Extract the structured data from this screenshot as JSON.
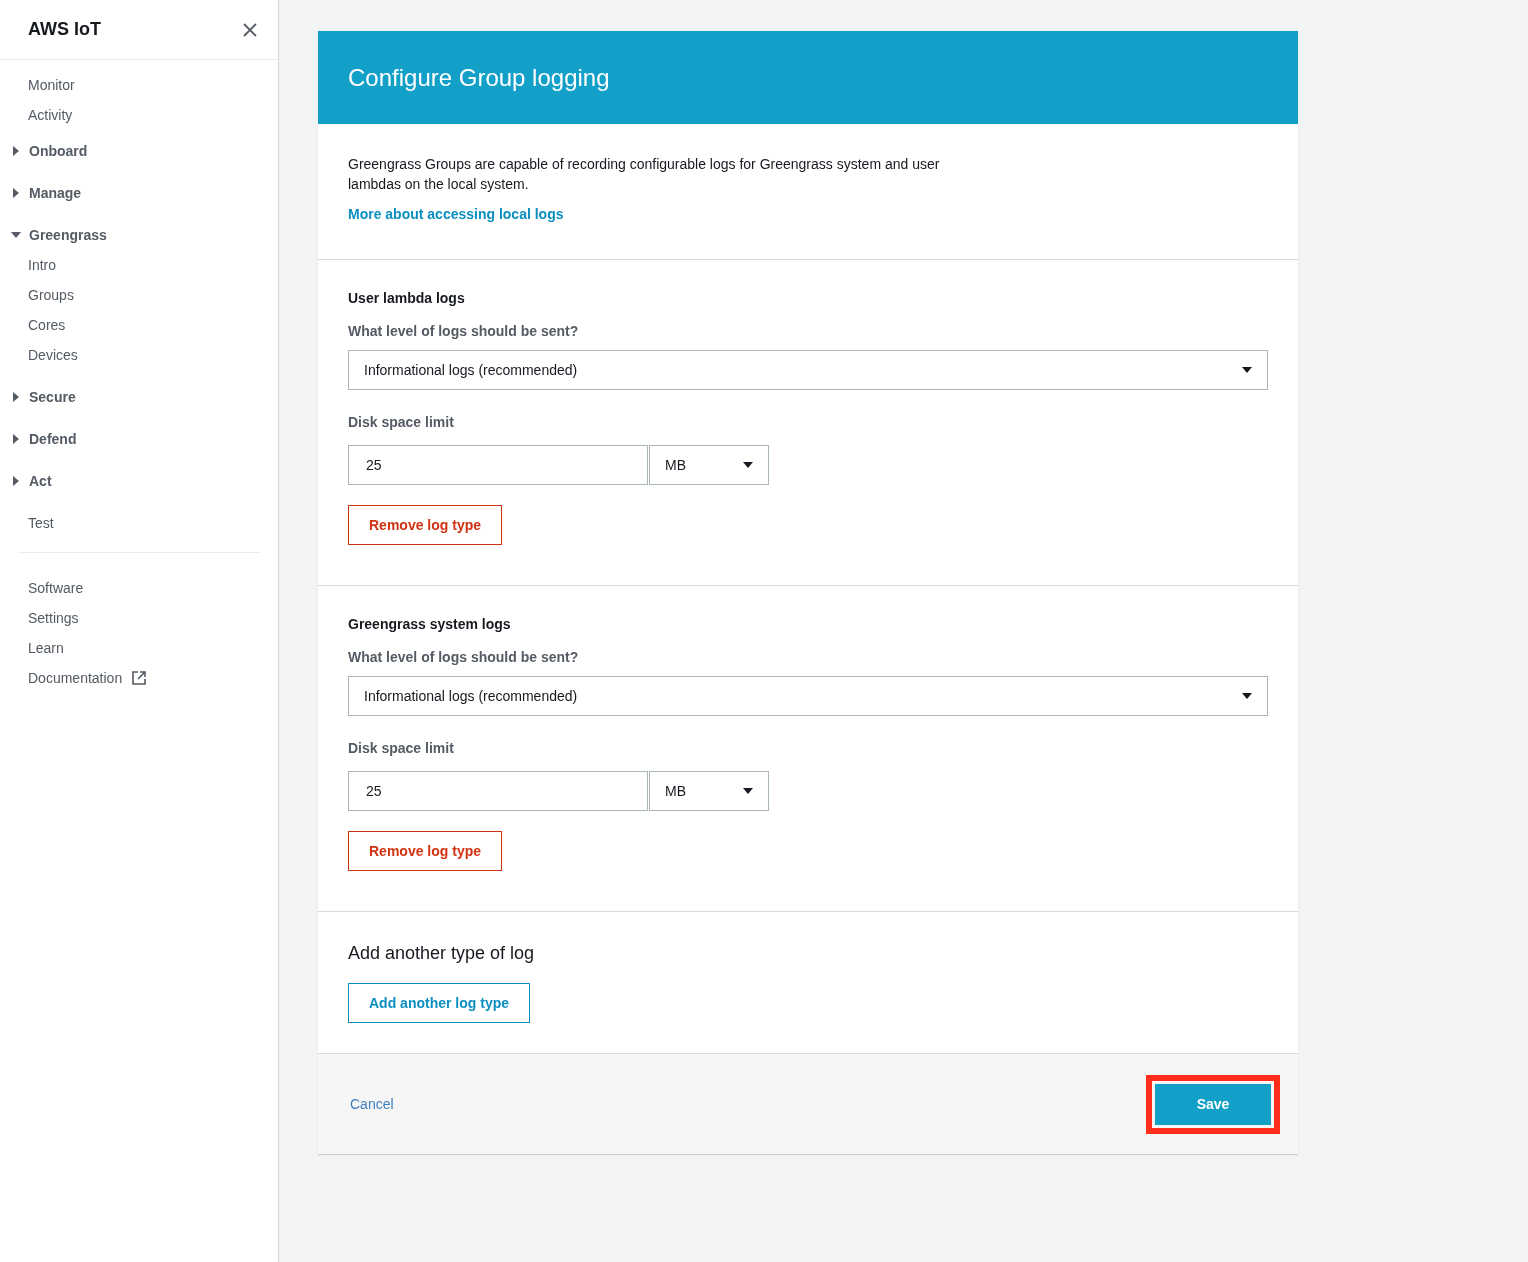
{
  "sidebar": {
    "title": "AWS IoT",
    "items": [
      {
        "kind": "link",
        "label": "Monitor"
      },
      {
        "kind": "link",
        "label": "Activity"
      },
      {
        "kind": "group",
        "label": "Onboard",
        "expanded": false
      },
      {
        "kind": "group",
        "label": "Manage",
        "expanded": false
      },
      {
        "kind": "group",
        "label": "Greengrass",
        "expanded": true,
        "children": [
          {
            "label": "Intro"
          },
          {
            "label": "Groups"
          },
          {
            "label": "Cores"
          },
          {
            "label": "Devices"
          }
        ]
      },
      {
        "kind": "group",
        "label": "Secure",
        "expanded": false
      },
      {
        "kind": "group",
        "label": "Defend",
        "expanded": false
      },
      {
        "kind": "group",
        "label": "Act",
        "expanded": false
      },
      {
        "kind": "link",
        "label": "Test"
      }
    ],
    "footer_items": [
      {
        "label": "Software",
        "external": false
      },
      {
        "label": "Settings",
        "external": false
      },
      {
        "label": "Learn",
        "external": false
      },
      {
        "label": "Documentation",
        "external": true
      }
    ]
  },
  "card": {
    "title": "Configure Group logging",
    "description": "Greengrass Groups are capable of recording configurable logs for Greengrass system and user lambdas on the local system.",
    "link": "More about accessing local logs",
    "log_types": [
      {
        "title": "User lambda logs",
        "level_label": "What level of logs should be sent?",
        "level_value": "Informational logs (recommended)",
        "disk_label": "Disk space limit",
        "disk_value": "25",
        "unit": "MB",
        "remove_button": "Remove log type"
      },
      {
        "title": "Greengrass system logs",
        "level_label": "What level of logs should be sent?",
        "level_value": "Informational logs (recommended)",
        "disk_label": "Disk space limit",
        "disk_value": "25",
        "unit": "MB",
        "remove_button": "Remove log type"
      }
    ],
    "add_section": {
      "heading": "Add another type of log",
      "button": "Add another log type"
    },
    "footer": {
      "cancel": "Cancel",
      "save": "Save",
      "save_highlighted": true
    }
  }
}
